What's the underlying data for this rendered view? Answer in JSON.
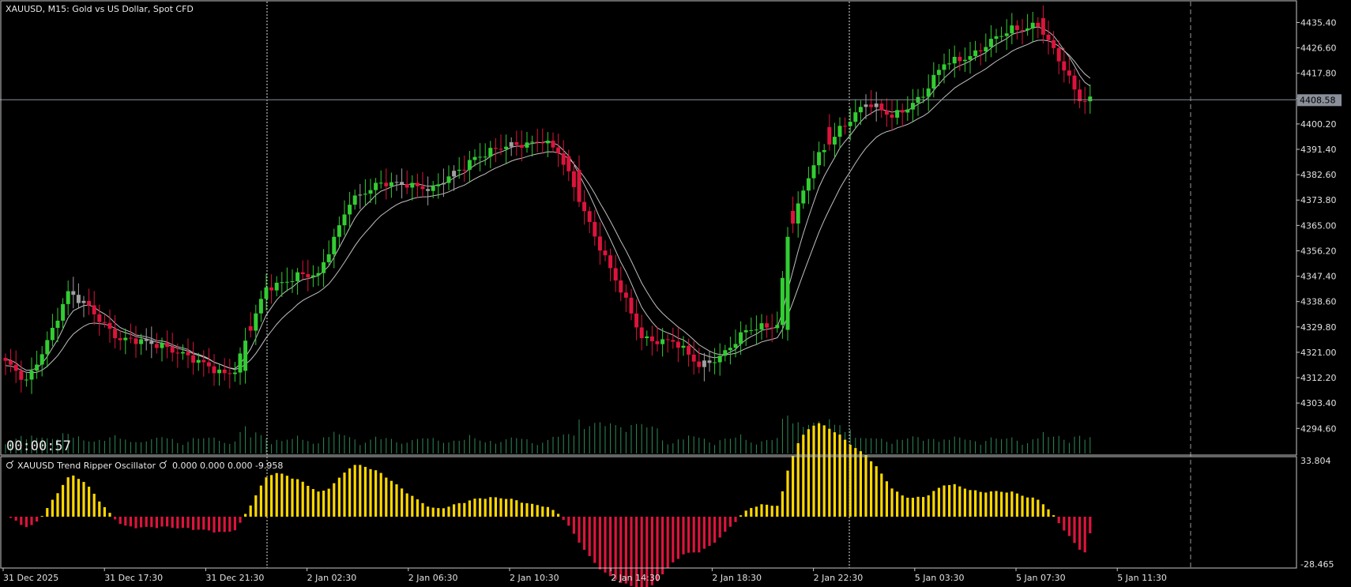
{
  "header": {
    "main_title": "XAUUSD, M15:  Gold vs US Dollar, Spot CFD",
    "indicator_title": "XAUUSD Trend Ripper Oscillator",
    "indicator_values": "0.000 0.000 0.000 -9.958",
    "countdown": "00:00:57"
  },
  "colors": {
    "background": "#000000",
    "bull_candle": "#32cd32",
    "bear_candle": "#dc143c",
    "neutral_candle": "#a0a0a0",
    "volume": "#2e8b57",
    "moving_average": "#c0c0c0",
    "osc_positive": "#ffd700",
    "osc_negative": "#dc143c",
    "grid_border": "#c8c8c8",
    "current_price_line": "#8a8f9a"
  },
  "chart_data": [
    {
      "type": "candlestick",
      "symbol": "XAUUSD",
      "timeframe": "M15",
      "current_price": 4408.58,
      "current_price_label": "4408.58",
      "ylim": [
        4287.0,
        4441.0
      ],
      "y_ticks": [
        "4435.40",
        "4426.60",
        "4417.80",
        "4409.00",
        "4400.20",
        "4391.40",
        "4382.60",
        "4373.80",
        "4365.00",
        "4356.20",
        "4347.40",
        "4338.60",
        "4329.80",
        "4321.00",
        "4312.20",
        "4303.40",
        "4294.60"
      ],
      "x_ticks": [
        "31 Dec 2025",
        "31 Dec 17:30",
        "31 Dec 21:30",
        "2 Jan 02:30",
        "2 Jan 06:30",
        "2 Jan 10:30",
        "2 Jan 14:30",
        "2 Jan 18:30",
        "2 Jan 22:30",
        "5 Jan 03:30",
        "5 Jan 07:30",
        "5 Jan 11:30"
      ],
      "session_separators": [
        "31 Dec 2025 23:00",
        "2 Jan 2026 23:00",
        "5 Jan 2026 13:00"
      ],
      "path_anchors": [
        {
          "bar": 0,
          "price": 4317
        },
        {
          "bar": 4,
          "price": 4311
        },
        {
          "bar": 8,
          "price": 4325
        },
        {
          "bar": 12,
          "price": 4341
        },
        {
          "bar": 16,
          "price": 4337
        },
        {
          "bar": 22,
          "price": 4325
        },
        {
          "bar": 30,
          "price": 4324
        },
        {
          "bar": 36,
          "price": 4318
        },
        {
          "bar": 42,
          "price": 4314
        },
        {
          "bar": 44,
          "price": 4315
        },
        {
          "bar": 50,
          "price": 4343
        },
        {
          "bar": 56,
          "price": 4348
        },
        {
          "bar": 60,
          "price": 4347
        },
        {
          "bar": 66,
          "price": 4374
        },
        {
          "bar": 72,
          "price": 4379
        },
        {
          "bar": 77,
          "price": 4380
        },
        {
          "bar": 82,
          "price": 4377
        },
        {
          "bar": 90,
          "price": 4389
        },
        {
          "bar": 96,
          "price": 4392
        },
        {
          "bar": 103,
          "price": 4395
        },
        {
          "bar": 106,
          "price": 4390
        },
        {
          "bar": 113,
          "price": 4362
        },
        {
          "bar": 118,
          "price": 4342
        },
        {
          "bar": 122,
          "price": 4326
        },
        {
          "bar": 128,
          "price": 4325
        },
        {
          "bar": 133,
          "price": 4316
        },
        {
          "bar": 137,
          "price": 4320
        },
        {
          "bar": 142,
          "price": 4328
        },
        {
          "bar": 148,
          "price": 4331
        },
        {
          "bar": 150,
          "price": 4362
        },
        {
          "bar": 155,
          "price": 4386
        },
        {
          "bar": 160,
          "price": 4399
        },
        {
          "bar": 165,
          "price": 4407
        },
        {
          "bar": 170,
          "price": 4403
        },
        {
          "bar": 176,
          "price": 4410
        },
        {
          "bar": 180,
          "price": 4421
        },
        {
          "bar": 186,
          "price": 4425
        },
        {
          "bar": 193,
          "price": 4433
        },
        {
          "bar": 198,
          "price": 4435
        },
        {
          "bar": 202,
          "price": 4422
        },
        {
          "bar": 206,
          "price": 4409
        }
      ],
      "neutral_bars": [
        13,
        14,
        15,
        27,
        28,
        68,
        75,
        76,
        81,
        84,
        86,
        97,
        134,
        135,
        165,
        167
      ]
    },
    {
      "type": "histogram",
      "name": "Trend Ripper Oscillator",
      "ylim": [
        -28.465,
        33.804
      ],
      "y_ticks": [
        "33.804",
        "-28.465"
      ],
      "last_value": -9.958
    }
  ]
}
